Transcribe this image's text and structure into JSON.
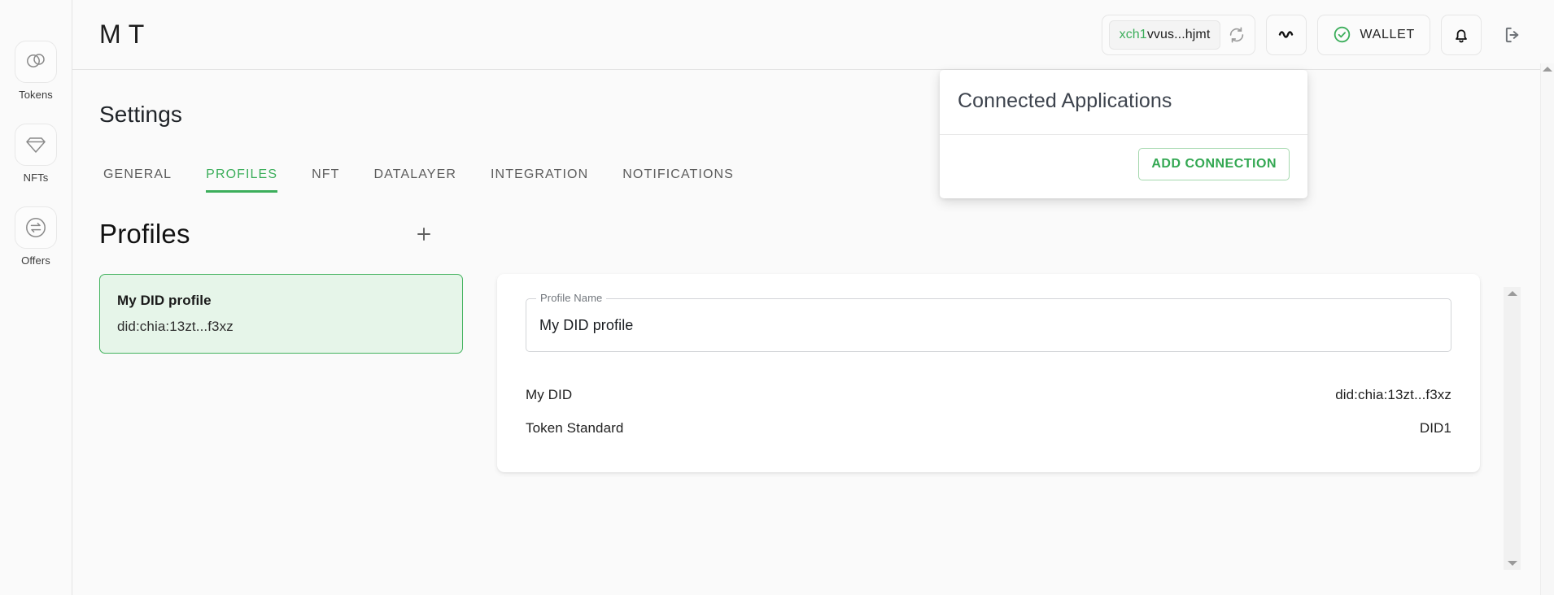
{
  "app": {
    "title": "M T"
  },
  "sidebar": {
    "items": [
      {
        "label": "Tokens",
        "icon": "tokens-icon"
      },
      {
        "label": "NFTs",
        "icon": "nft-diamond-icon"
      },
      {
        "label": "Offers",
        "icon": "offers-swap-icon"
      }
    ]
  },
  "topbar": {
    "address_prefix": "xch1",
    "address_rest": "vvus...hjmt",
    "refresh_icon": "refresh-icon",
    "status_icon": "pulse-icon",
    "wallet_label": "WALLET",
    "wallet_status_icon": "check-circle-icon",
    "notifications_icon": "bell-icon",
    "logout_icon": "logout-icon"
  },
  "dropdown": {
    "title": "Connected Applications",
    "add_connection_label": "ADD CONNECTION"
  },
  "page": {
    "heading": "Settings",
    "tabs": [
      {
        "label": "GENERAL",
        "active": false
      },
      {
        "label": "PROFILES",
        "active": true
      },
      {
        "label": "NFT",
        "active": false
      },
      {
        "label": "DATALAYER",
        "active": false
      },
      {
        "label": "INTEGRATION",
        "active": false
      },
      {
        "label": "NOTIFICATIONS",
        "active": false
      }
    ],
    "section_title": "Profiles",
    "add_profile_icon": "plus-icon"
  },
  "profile_list": [
    {
      "name": "My DID profile",
      "did": "did:chia:13zt...f3xz"
    }
  ],
  "detail": {
    "field_label": "Profile Name",
    "field_value": "My DID profile",
    "rows": [
      {
        "key": "My DID",
        "value": "did:chia:13zt...f3xz"
      },
      {
        "key": "Token Standard",
        "value": "DID1"
      }
    ]
  },
  "colors": {
    "accent_green": "#3cae5b",
    "card_green_bg": "#e6f5e9",
    "card_green_border": "#44b35f",
    "text_primary": "#1f1f1f",
    "surface": "#ffffff",
    "background": "#fafafa"
  }
}
